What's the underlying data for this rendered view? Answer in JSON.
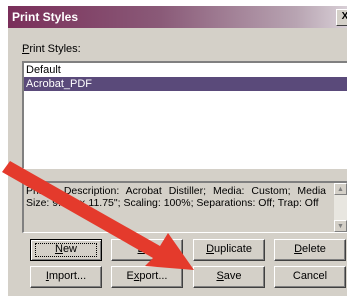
{
  "window": {
    "title": "Print Styles",
    "close_glyph": "X"
  },
  "list": {
    "label_accel": "P",
    "label_rest": "rint Styles:",
    "items": [
      "Default",
      "Acrobat_PDF"
    ],
    "selected_index": 1
  },
  "description": "Printer Description: Acrobat Distiller;  Media: Custom;  Media Size: 9.25\" × 11.75\";  Scaling: 100%;  Separations: Off;  Trap: Off",
  "buttons": {
    "new": {
      "pre": "",
      "accel": "N",
      "post": "ew"
    },
    "edit": {
      "pre": "",
      "accel": "E",
      "post": "dit"
    },
    "duplicate": {
      "pre": "",
      "accel": "D",
      "post": "uplicate"
    },
    "delete": {
      "pre": "",
      "accel": "D",
      "post": "elete"
    },
    "import": {
      "pre": "",
      "accel": "I",
      "post": "mport..."
    },
    "export": {
      "pre": "E",
      "accel": "x",
      "post": "port..."
    },
    "save": {
      "pre": "",
      "accel": "S",
      "post": "ave"
    },
    "cancel": {
      "pre": "Cancel",
      "accel": "",
      "post": ""
    }
  },
  "colors": {
    "arrow": "#e43a2c",
    "selection": "#5a4a7a",
    "face": "#d4d0c8"
  },
  "icons": {
    "scroll_up": "scroll-up-icon",
    "scroll_down": "scroll-down-icon",
    "annotation": "red-arrow-icon"
  }
}
